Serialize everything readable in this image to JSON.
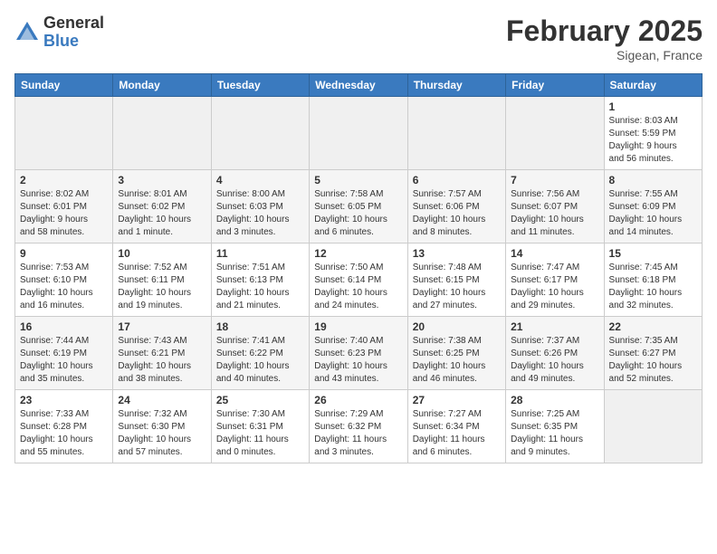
{
  "logo": {
    "general": "General",
    "blue": "Blue"
  },
  "title": {
    "month": "February 2025",
    "location": "Sigean, France"
  },
  "weekdays": [
    "Sunday",
    "Monday",
    "Tuesday",
    "Wednesday",
    "Thursday",
    "Friday",
    "Saturday"
  ],
  "weeks": [
    [
      {
        "day": "",
        "info": ""
      },
      {
        "day": "",
        "info": ""
      },
      {
        "day": "",
        "info": ""
      },
      {
        "day": "",
        "info": ""
      },
      {
        "day": "",
        "info": ""
      },
      {
        "day": "",
        "info": ""
      },
      {
        "day": "1",
        "info": "Sunrise: 8:03 AM\nSunset: 5:59 PM\nDaylight: 9 hours\nand 56 minutes."
      }
    ],
    [
      {
        "day": "2",
        "info": "Sunrise: 8:02 AM\nSunset: 6:01 PM\nDaylight: 9 hours\nand 58 minutes."
      },
      {
        "day": "3",
        "info": "Sunrise: 8:01 AM\nSunset: 6:02 PM\nDaylight: 10 hours\nand 1 minute."
      },
      {
        "day": "4",
        "info": "Sunrise: 8:00 AM\nSunset: 6:03 PM\nDaylight: 10 hours\nand 3 minutes."
      },
      {
        "day": "5",
        "info": "Sunrise: 7:58 AM\nSunset: 6:05 PM\nDaylight: 10 hours\nand 6 minutes."
      },
      {
        "day": "6",
        "info": "Sunrise: 7:57 AM\nSunset: 6:06 PM\nDaylight: 10 hours\nand 8 minutes."
      },
      {
        "day": "7",
        "info": "Sunrise: 7:56 AM\nSunset: 6:07 PM\nDaylight: 10 hours\nand 11 minutes."
      },
      {
        "day": "8",
        "info": "Sunrise: 7:55 AM\nSunset: 6:09 PM\nDaylight: 10 hours\nand 14 minutes."
      }
    ],
    [
      {
        "day": "9",
        "info": "Sunrise: 7:53 AM\nSunset: 6:10 PM\nDaylight: 10 hours\nand 16 minutes."
      },
      {
        "day": "10",
        "info": "Sunrise: 7:52 AM\nSunset: 6:11 PM\nDaylight: 10 hours\nand 19 minutes."
      },
      {
        "day": "11",
        "info": "Sunrise: 7:51 AM\nSunset: 6:13 PM\nDaylight: 10 hours\nand 21 minutes."
      },
      {
        "day": "12",
        "info": "Sunrise: 7:50 AM\nSunset: 6:14 PM\nDaylight: 10 hours\nand 24 minutes."
      },
      {
        "day": "13",
        "info": "Sunrise: 7:48 AM\nSunset: 6:15 PM\nDaylight: 10 hours\nand 27 minutes."
      },
      {
        "day": "14",
        "info": "Sunrise: 7:47 AM\nSunset: 6:17 PM\nDaylight: 10 hours\nand 29 minutes."
      },
      {
        "day": "15",
        "info": "Sunrise: 7:45 AM\nSunset: 6:18 PM\nDaylight: 10 hours\nand 32 minutes."
      }
    ],
    [
      {
        "day": "16",
        "info": "Sunrise: 7:44 AM\nSunset: 6:19 PM\nDaylight: 10 hours\nand 35 minutes."
      },
      {
        "day": "17",
        "info": "Sunrise: 7:43 AM\nSunset: 6:21 PM\nDaylight: 10 hours\nand 38 minutes."
      },
      {
        "day": "18",
        "info": "Sunrise: 7:41 AM\nSunset: 6:22 PM\nDaylight: 10 hours\nand 40 minutes."
      },
      {
        "day": "19",
        "info": "Sunrise: 7:40 AM\nSunset: 6:23 PM\nDaylight: 10 hours\nand 43 minutes."
      },
      {
        "day": "20",
        "info": "Sunrise: 7:38 AM\nSunset: 6:25 PM\nDaylight: 10 hours\nand 46 minutes."
      },
      {
        "day": "21",
        "info": "Sunrise: 7:37 AM\nSunset: 6:26 PM\nDaylight: 10 hours\nand 49 minutes."
      },
      {
        "day": "22",
        "info": "Sunrise: 7:35 AM\nSunset: 6:27 PM\nDaylight: 10 hours\nand 52 minutes."
      }
    ],
    [
      {
        "day": "23",
        "info": "Sunrise: 7:33 AM\nSunset: 6:28 PM\nDaylight: 10 hours\nand 55 minutes."
      },
      {
        "day": "24",
        "info": "Sunrise: 7:32 AM\nSunset: 6:30 PM\nDaylight: 10 hours\nand 57 minutes."
      },
      {
        "day": "25",
        "info": "Sunrise: 7:30 AM\nSunset: 6:31 PM\nDaylight: 11 hours\nand 0 minutes."
      },
      {
        "day": "26",
        "info": "Sunrise: 7:29 AM\nSunset: 6:32 PM\nDaylight: 11 hours\nand 3 minutes."
      },
      {
        "day": "27",
        "info": "Sunrise: 7:27 AM\nSunset: 6:34 PM\nDaylight: 11 hours\nand 6 minutes."
      },
      {
        "day": "28",
        "info": "Sunrise: 7:25 AM\nSunset: 6:35 PM\nDaylight: 11 hours\nand 9 minutes."
      },
      {
        "day": "",
        "info": ""
      }
    ]
  ]
}
